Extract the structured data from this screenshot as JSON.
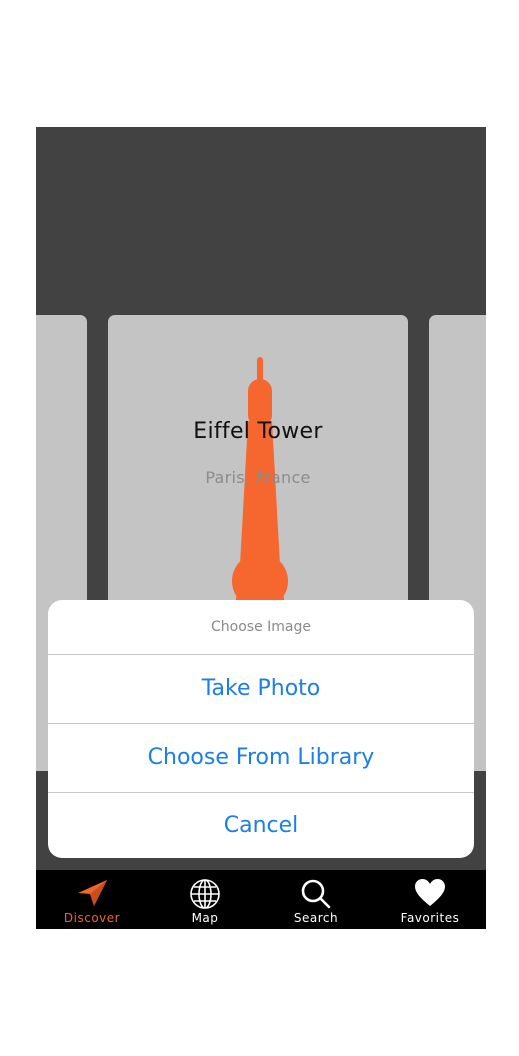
{
  "card": {
    "title": "Eiffel Tower",
    "subtitle": "Paris, France"
  },
  "action_sheet": {
    "title": "Choose Image",
    "buttons": [
      "Take Photo",
      "Choose From Library",
      "Cancel"
    ]
  },
  "tabbar": {
    "active": "Discover",
    "tabs": [
      {
        "label": "Discover",
        "icon": "paper-plane-icon"
      },
      {
        "label": "Map",
        "icon": "globe-icon"
      },
      {
        "label": "Search",
        "icon": "search-icon"
      },
      {
        "label": "Favorites",
        "icon": "heart-icon"
      }
    ]
  },
  "colors": {
    "accent": "#f26430",
    "background": "#424242",
    "card": "#c4c4c4",
    "link": "#1a7fe6"
  }
}
